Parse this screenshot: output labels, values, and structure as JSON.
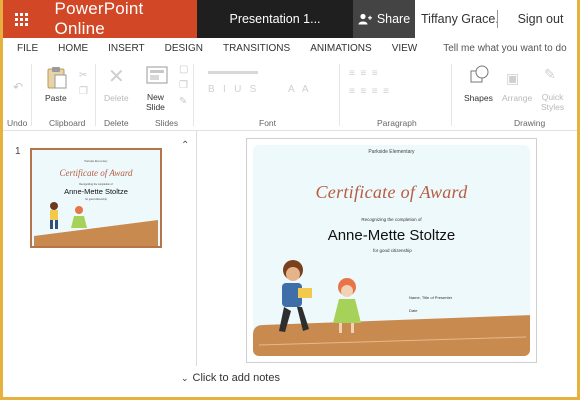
{
  "window": {
    "app_name": "PowerPoint Online",
    "doc_title": "Presentation 1...",
    "share_label": "Share",
    "user_name": "Tiffany Grace...",
    "sign_out": "Sign out"
  },
  "tabs": [
    "FILE",
    "HOME",
    "INSERT",
    "DESIGN",
    "TRANSITIONS",
    "ANIMATIONS",
    "VIEW"
  ],
  "tell_me": "Tell me what you want to do",
  "ribbon": {
    "buttons": {
      "paste": "Paste",
      "delete": "Delete",
      "new_slide_line1": "New",
      "new_slide_line2": "Slide",
      "shapes": "Shapes",
      "arrange": "Arrange",
      "quick_styles_line1": "Quick",
      "quick_styles_line2": "Styles"
    },
    "groups": {
      "undo": "Undo",
      "clipboard": "Clipboard",
      "delete": "Delete",
      "slides": "Slides",
      "font": "Font",
      "paragraph": "Paragraph",
      "drawing": "Drawing"
    }
  },
  "thumbnail": {
    "number": "1"
  },
  "slide": {
    "school": "Parkside Elementary",
    "title": "Certificate of Award",
    "recognizing": "Recognizing the completion of",
    "recipient": "Anne-Mette Stoltze",
    "for": "for good citizenship",
    "signature": "Name, Title of Presenter",
    "date": "Date"
  },
  "notes": {
    "label": "Click to add notes"
  },
  "colors": {
    "brand": "#d24726",
    "title_dark": "#1f1f1f",
    "share_bg": "#444444",
    "frame": "#e7b13f",
    "certificate_title": "#b65c43",
    "ground": "#c98a4f",
    "slide_bg": "#eef9fb"
  }
}
